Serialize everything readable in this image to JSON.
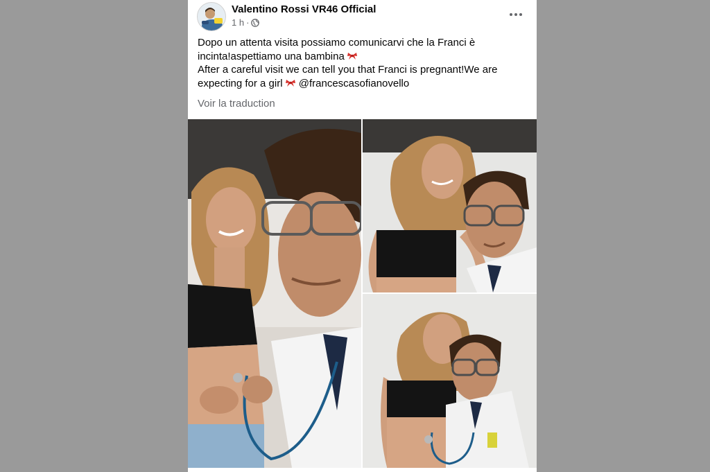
{
  "post": {
    "author": "Valentino Rossi VR46 Official",
    "time": "1 h",
    "separator": "·",
    "audience_icon": "globe-icon",
    "more_icon": "more-options-icon",
    "text_it_1": "Dopo un attenta visita possiamo comunicarvi che la Franci è incinta!aspettiamo una bambina",
    "text_en_1": "After a careful visit we can tell you that Franci is pregnant!We are expecting for a girl",
    "ribbon_icon": "ribbon-emoji-icon",
    "mention": "@francescasofianovello",
    "translate_label": "Voir la traduction"
  },
  "photos": [
    {
      "name": "photo-main",
      "description_icon": "photo"
    },
    {
      "name": "photo-top-right",
      "description_icon": "photo"
    },
    {
      "name": "photo-bottom-right",
      "description_icon": "photo"
    }
  ],
  "colors": {
    "background": "#9a9a9a",
    "card": "#ffffff",
    "text_primary": "#050505",
    "text_secondary": "#65676b"
  }
}
